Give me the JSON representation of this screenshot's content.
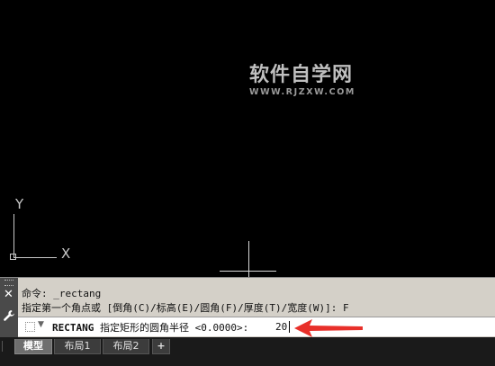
{
  "watermark": {
    "title": "软件自学网",
    "url": "WWW.RJZXW.COM"
  },
  "ucs": {
    "y_label": "Y",
    "x_label": "X"
  },
  "command": {
    "history": [
      "命令: _rectang",
      "指定第一个角点或 [倒角(C)/标高(E)/圆角(F)/厚度(T)/宽度(W)]: F"
    ],
    "prompt_keyword": "RECTANG",
    "prompt_text": " 指定矩形的圆角半径 <0.0000>: ",
    "input_value": "20"
  },
  "tabs": [
    {
      "label": "模型",
      "active": true
    },
    {
      "label": "布局1",
      "active": false
    },
    {
      "label": "布局2",
      "active": false
    },
    {
      "label": "+",
      "active": false
    }
  ],
  "colors": {
    "canvas": "#000000",
    "command_panel": "#d4d0c8",
    "annotation_arrow": "#e8302a"
  },
  "icons": {
    "close": "close-icon",
    "customize": "wrench-icon",
    "prompt": "command-prompt-icon"
  }
}
